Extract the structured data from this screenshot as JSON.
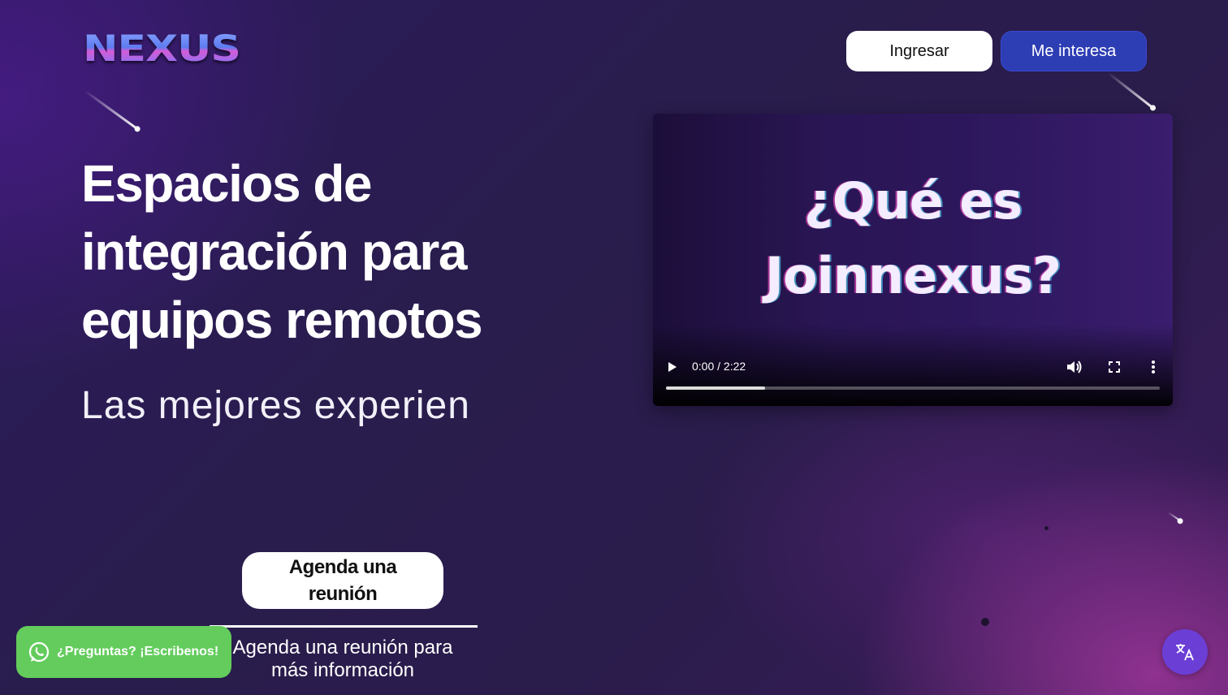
{
  "header": {
    "logo_text": "NEXUS",
    "login_label": "Ingresar",
    "interest_label": "Me interesa"
  },
  "hero": {
    "title": "Espacios de integración para equipos remotos",
    "subtitle": "Las mejores experien"
  },
  "video": {
    "title_line1": "¿Qué es",
    "title_line2": "Joinnexus?",
    "time": "0:00 / 2:22",
    "progress": 0.2
  },
  "cta": {
    "button_label": "Agenda una reunión",
    "caption": "Agenda una reunión para más información"
  },
  "whatsapp": {
    "label": "¿Preguntas? ¡Escribenos!"
  },
  "colors": {
    "accent": "#2d3db4",
    "whatsapp": "#63cc5c",
    "translate": "#6b3fd6"
  },
  "icons": [
    "whatsapp-icon",
    "translate-icon",
    "play-icon",
    "volume-icon",
    "fullscreen-icon",
    "more-vert-icon"
  ]
}
